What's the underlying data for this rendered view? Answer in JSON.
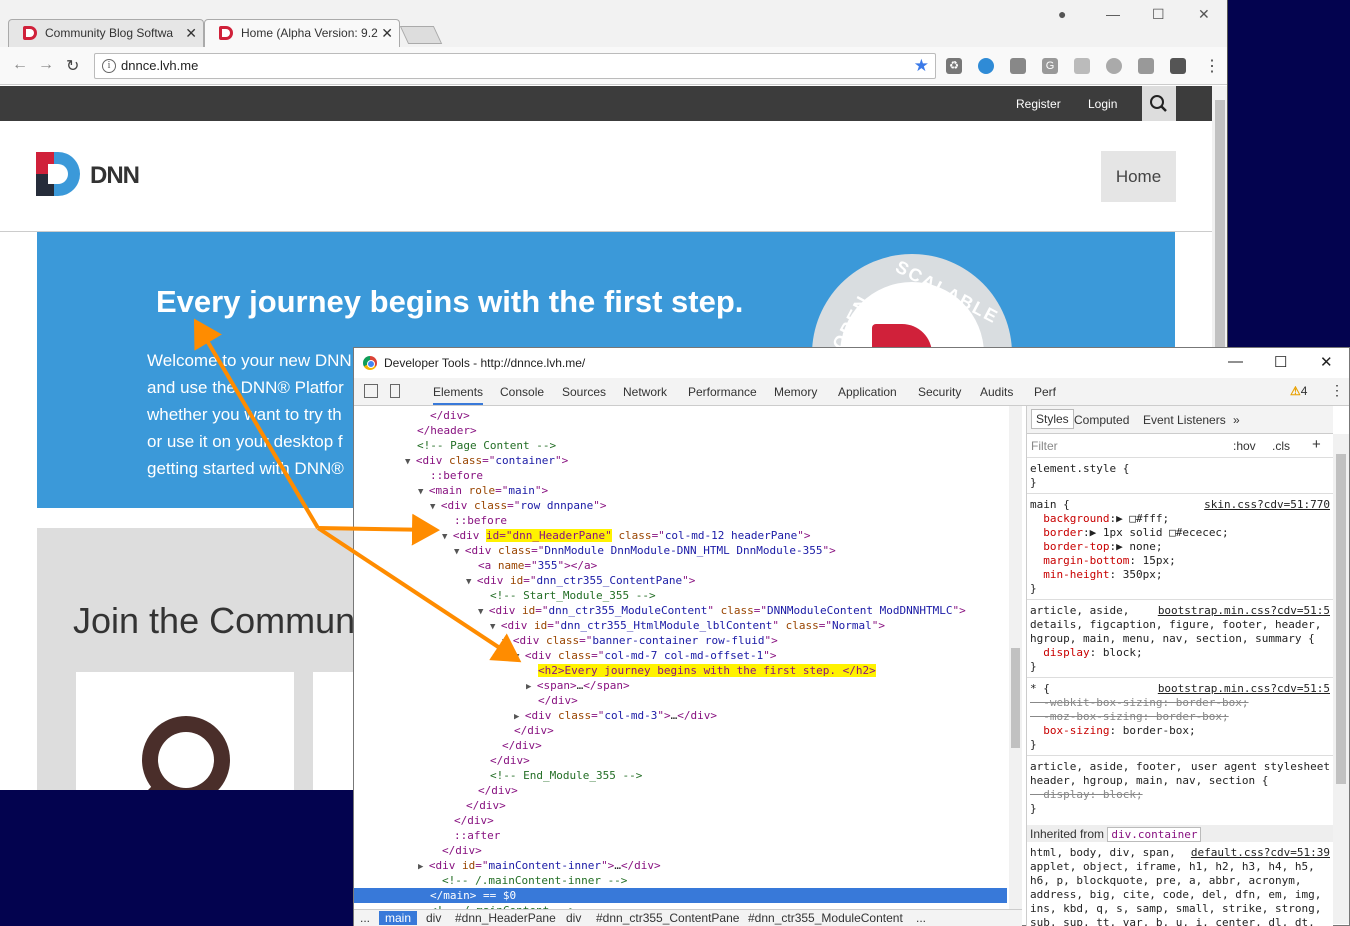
{
  "browser": {
    "tabs": [
      {
        "title": "Community Blog Softwa",
        "active": false
      },
      {
        "title": "Home (Alpha Version: 9.2",
        "active": true
      }
    ],
    "url": "dnnce.lvh.me",
    "ext_icons": [
      "recycle-icon",
      "globe-icon",
      "feed-icon",
      "g-icon",
      "react-icon",
      "ghost-icon",
      "pdf-icon",
      "note-icon"
    ]
  },
  "site": {
    "top_links": {
      "register": "Register",
      "login": "Login"
    },
    "logo_text": "DNN",
    "nav_home": "Home",
    "banner": {
      "heading": "Every journey begins with the first step.",
      "intro_lines": [
        "Welcome to your new DNN",
        "and use the DNN® Platfor",
        "whether you want to try th",
        "or use it on your desktop f",
        "getting started with DNN®"
      ],
      "badge_words": {
        "left": "OPEN",
        "right": "SCALABLE"
      }
    },
    "join_heading": "Join the Commun"
  },
  "devtools": {
    "title": "Developer Tools - http://dnnce.lvh.me/",
    "tabs": [
      "Elements",
      "Console",
      "Sources",
      "Network",
      "Performance",
      "Memory",
      "Application",
      "Security",
      "Audits",
      "Perf"
    ],
    "warning_count": "4",
    "dom_lines": [
      {
        "indent": 76,
        "parts": [
          [
            "t",
            "</div>"
          ]
        ]
      },
      {
        "indent": 63,
        "parts": [
          [
            "t",
            "</header>"
          ]
        ]
      },
      {
        "indent": 63,
        "parts": [
          [
            "c",
            "<!-- Page Content -->"
          ]
        ]
      },
      {
        "indent": 63,
        "tri": "▼",
        "parts": [
          [
            "t",
            "<div "
          ],
          [
            "a",
            "class"
          ],
          [
            "t",
            "=\""
          ],
          [
            "v",
            "container"
          ],
          [
            "t",
            "\">"
          ]
        ]
      },
      {
        "indent": 76,
        "parts": [
          [
            "p",
            "::before"
          ]
        ]
      },
      {
        "indent": 76,
        "tri": "▼",
        "parts": [
          [
            "t",
            "<main "
          ],
          [
            "a",
            "role"
          ],
          [
            "t",
            "=\""
          ],
          [
            "v",
            "main"
          ],
          [
            "t",
            "\">"
          ]
        ]
      },
      {
        "indent": 88,
        "tri": "▼",
        "parts": [
          [
            "t",
            "<div "
          ],
          [
            "a",
            "class"
          ],
          [
            "t",
            "=\""
          ],
          [
            "v",
            "row dnnpane"
          ],
          [
            "t",
            "\">"
          ]
        ]
      },
      {
        "indent": 100,
        "parts": [
          [
            "p",
            "::before"
          ]
        ]
      },
      {
        "indent": 100,
        "tri": "▼",
        "parts": [
          [
            "t",
            "<div "
          ],
          [
            "h",
            "id=\"dnn_HeaderPane\""
          ],
          [
            "t",
            " "
          ],
          [
            "a",
            "class"
          ],
          [
            "t",
            "=\""
          ],
          [
            "v",
            "col-md-12 headerPane"
          ],
          [
            "t",
            "\">"
          ]
        ]
      },
      {
        "indent": 112,
        "tri": "▼",
        "parts": [
          [
            "t",
            "<div "
          ],
          [
            "a",
            "class"
          ],
          [
            "t",
            "=\""
          ],
          [
            "v",
            "DnnModule DnnModule-DNN_HTML DnnModule-355"
          ],
          [
            "t",
            "\">"
          ]
        ]
      },
      {
        "indent": 124,
        "parts": [
          [
            "t",
            "<a "
          ],
          [
            "a",
            "name"
          ],
          [
            "t",
            "=\""
          ],
          [
            "v",
            "355"
          ],
          [
            "t",
            "\"></a>"
          ]
        ]
      },
      {
        "indent": 124,
        "tri": "▼",
        "parts": [
          [
            "t",
            "<div "
          ],
          [
            "a",
            "id"
          ],
          [
            "t",
            "=\""
          ],
          [
            "v",
            "dnn_ctr355_ContentPane"
          ],
          [
            "t",
            "\">"
          ]
        ]
      },
      {
        "indent": 136,
        "parts": [
          [
            "c",
            "<!-- Start_Module_355 -->"
          ]
        ]
      },
      {
        "indent": 136,
        "tri": "▼",
        "parts": [
          [
            "t",
            "<div "
          ],
          [
            "a",
            "id"
          ],
          [
            "t",
            "=\""
          ],
          [
            "v",
            "dnn_ctr355_ModuleContent"
          ],
          [
            "t",
            "\" "
          ],
          [
            "a",
            "class"
          ],
          [
            "t",
            "=\""
          ],
          [
            "v",
            "DNNModuleContent ModDNNHTMLC"
          ],
          [
            "t",
            "\">"
          ]
        ]
      },
      {
        "indent": 148,
        "tri": "▼",
        "parts": [
          [
            "t",
            "<div "
          ],
          [
            "a",
            "id"
          ],
          [
            "t",
            "=\""
          ],
          [
            "v",
            "dnn_ctr355_HtmlModule_lblContent"
          ],
          [
            "t",
            "\" "
          ],
          [
            "a",
            "class"
          ],
          [
            "t",
            "=\""
          ],
          [
            "v",
            "Normal"
          ],
          [
            "t",
            "\">"
          ]
        ]
      },
      {
        "indent": 160,
        "tri": "▼",
        "parts": [
          [
            "t",
            "<div "
          ],
          [
            "a",
            "class"
          ],
          [
            "t",
            "=\""
          ],
          [
            "v",
            "banner-container row-fluid"
          ],
          [
            "t",
            "\">"
          ]
        ]
      },
      {
        "indent": 172,
        "tri": "▼",
        "parts": [
          [
            "t",
            "<div "
          ],
          [
            "a",
            "class"
          ],
          [
            "t",
            "=\""
          ],
          [
            "v",
            "col-md-7 col-md-offset-1"
          ],
          [
            "t",
            "\">"
          ]
        ]
      },
      {
        "indent": 184,
        "parts": [
          [
            "h",
            "<h2>Every journey begins with the first step. </h2>"
          ]
        ]
      },
      {
        "indent": 184,
        "tri": "▶",
        "parts": [
          [
            "t",
            "<span>"
          ],
          [
            "x",
            "…"
          ],
          [
            "t",
            "</span>"
          ]
        ]
      },
      {
        "indent": 184,
        "parts": [
          [
            "t",
            "</div>"
          ]
        ]
      },
      {
        "indent": 172,
        "tri": "▶",
        "parts": [
          [
            "t",
            "<div "
          ],
          [
            "a",
            "class"
          ],
          [
            "t",
            "=\""
          ],
          [
            "v",
            "col-md-3"
          ],
          [
            "t",
            "\">"
          ],
          [
            "x",
            "…"
          ],
          [
            "t",
            "</div>"
          ]
        ]
      },
      {
        "indent": 160,
        "parts": [
          [
            "t",
            "</div>"
          ]
        ]
      },
      {
        "indent": 148,
        "parts": [
          [
            "t",
            "</div>"
          ]
        ]
      },
      {
        "indent": 136,
        "parts": [
          [
            "t",
            "</div>"
          ]
        ]
      },
      {
        "indent": 136,
        "parts": [
          [
            "c",
            "<!-- End_Module_355 -->"
          ]
        ]
      },
      {
        "indent": 124,
        "parts": [
          [
            "t",
            "</div>"
          ]
        ]
      },
      {
        "indent": 112,
        "parts": [
          [
            "t",
            "</div>"
          ]
        ]
      },
      {
        "indent": 100,
        "parts": [
          [
            "t",
            "</div>"
          ]
        ]
      },
      {
        "indent": 100,
        "parts": [
          [
            "p",
            "::after"
          ]
        ]
      },
      {
        "indent": 88,
        "parts": [
          [
            "t",
            "</div>"
          ]
        ]
      },
      {
        "indent": 76,
        "tri": "▶",
        "parts": [
          [
            "t",
            "<div "
          ],
          [
            "a",
            "id"
          ],
          [
            "t",
            "=\""
          ],
          [
            "v",
            "mainContent-inner"
          ],
          [
            "t",
            "\">"
          ],
          [
            "x",
            "…"
          ],
          [
            "t",
            "</div>"
          ]
        ]
      },
      {
        "indent": 88,
        "parts": [
          [
            "c",
            "<!-- /.mainContent-inner -->"
          ]
        ]
      },
      {
        "indent": 76,
        "selected": true,
        "parts": [
          [
            "t",
            "</main>"
          ],
          [
            "c",
            " == $0"
          ]
        ]
      },
      {
        "indent": 76,
        "parts": [
          [
            "c",
            "<!-- /.mainContent -->"
          ]
        ]
      }
    ],
    "breadcrumbs": [
      "...",
      "main",
      "div",
      "#dnn_HeaderPane",
      "div",
      "#dnn_ctr355_ContentPane",
      "#dnn_ctr355_ModuleContent",
      "..."
    ],
    "styles_tabs": [
      "Styles",
      "Computed",
      "Event Listeners",
      "»"
    ],
    "filter": {
      "placeholder": "Filter",
      "hov": ":hov",
      "cls": ".cls",
      "plus": "+"
    },
    "rules": [
      {
        "type": "plain",
        "text": "element.style {"
      },
      {
        "type": "plain",
        "text": "}"
      },
      {
        "type": "sel_src",
        "text": "main {",
        "src": "skin.css?cdv=51:770"
      },
      {
        "type": "prop",
        "name": "background",
        "value": "▶ □#fff;"
      },
      {
        "type": "prop",
        "name": "border",
        "value": "▶ 1px solid □#ececec;"
      },
      {
        "type": "prop",
        "name": "border-top",
        "value": "▶ none;"
      },
      {
        "type": "prop",
        "name": "margin-bottom",
        "value": " 15px;"
      },
      {
        "type": "prop",
        "name": "min-height",
        "value": " 350px;"
      },
      {
        "type": "plain",
        "text": "}"
      },
      {
        "type": "sel_src",
        "text": "article, aside,",
        "src": "bootstrap.min.css?cdv=51:5"
      },
      {
        "type": "plain",
        "text": "details, figcaption, figure, footer, header,"
      },
      {
        "type": "plain",
        "text": "hgroup, main, menu, nav, section, summary {"
      },
      {
        "type": "prop",
        "name": "display",
        "value": " block;"
      },
      {
        "type": "plain",
        "text": "}"
      },
      {
        "type": "sel_src",
        "text": "* {",
        "src": "bootstrap.min.css?cdv=51:5"
      },
      {
        "type": "strike",
        "text": "  -webkit-box-sizing: border-box;"
      },
      {
        "type": "strike",
        "text": "  -moz-box-sizing: border-box;"
      },
      {
        "type": "prop",
        "name": "box-sizing",
        "value": " border-box;"
      },
      {
        "type": "plain",
        "text": "}"
      },
      {
        "type": "sel_ua",
        "text": "article, aside, footer,",
        "src": "user agent stylesheet"
      },
      {
        "type": "plain",
        "text": "header, hgroup, main, nav, section {"
      },
      {
        "type": "strike",
        "text": "  display: block;"
      },
      {
        "type": "plain",
        "text": "}"
      }
    ],
    "inherited_label": "Inherited from",
    "inherited_el": "div.container",
    "inherited_rule": {
      "src": "default.css?cdv=51:39",
      "lines": [
        "html, body, div, span,",
        "applet, object, iframe, h1, h2, h3, h4, h5,",
        "h6, p, blockquote, pre, a, abbr, acronym,",
        "address, big, cite, code, del, dfn, em, img,",
        "ins, kbd, q, s, samp, small, strike, strong,",
        "sub, sup, tt, var, b, u, i, center, dl, dt,"
      ]
    }
  }
}
